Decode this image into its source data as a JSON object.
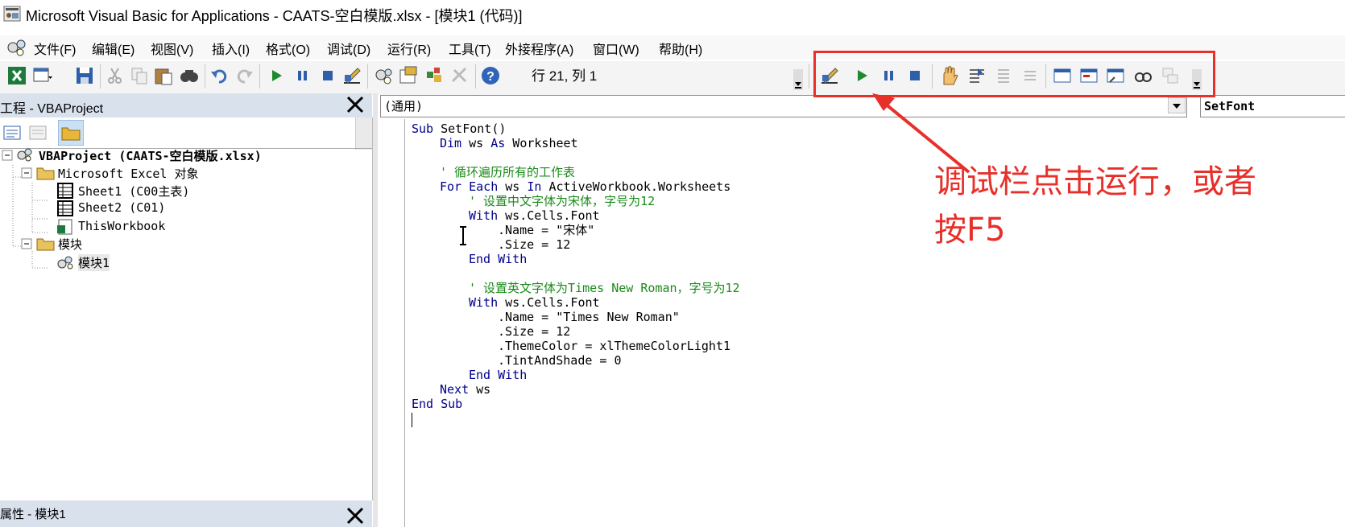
{
  "window": {
    "title": "Microsoft Visual Basic for Applications - CAATS-空白模版.xlsx - [模块1 (代码)]"
  },
  "menu": [
    "文件(F)",
    "编辑(E)",
    "视图(V)",
    "插入(I)",
    "格式(O)",
    "调试(D)",
    "运行(R)",
    "工具(T)",
    "外接程序(A)",
    "窗口(W)",
    "帮助(H)"
  ],
  "toolbar": {
    "position_readout": "行 21, 列 1"
  },
  "project_panel": {
    "title": "工程 - VBAProject",
    "root": "VBAProject (CAATS-空白模版.xlsx)",
    "excel_objects_folder": "Microsoft Excel 对象",
    "sheet1": "Sheet1 (C00主表)",
    "sheet2": "Sheet2 (C01)",
    "thisworkbook": "ThisWorkbook",
    "modules_folder": "模块",
    "module1": "模块1"
  },
  "properties_panel": {
    "title": "属性 - 模块1"
  },
  "code_window": {
    "object_dropdown": "(通用)",
    "procedure_dropdown": "SetFont"
  },
  "annotation": {
    "text": "调试栏点击运行，或者\n按F5"
  },
  "colors": {
    "accent_red": "#e8302a",
    "keyword_blue": "#00008b",
    "comment_green": "#1a8a1a"
  }
}
